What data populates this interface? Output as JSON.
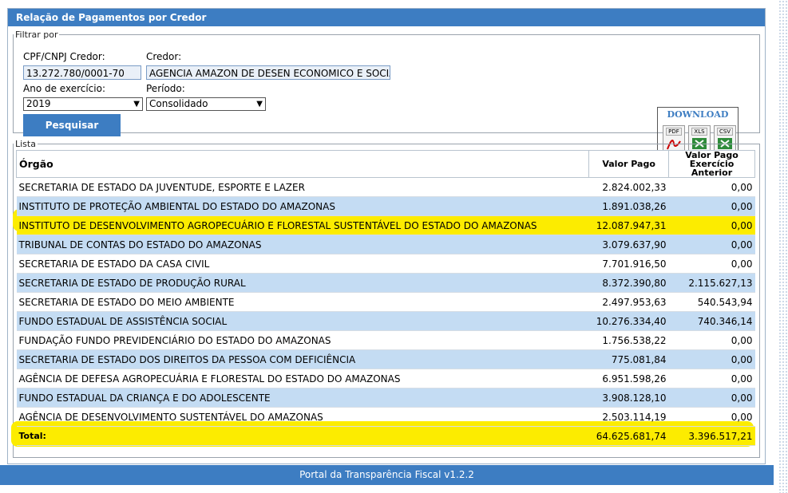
{
  "panel": {
    "title": "Relação de Pagamentos por Credor"
  },
  "filter": {
    "legend": "Filtrar por",
    "cpf_label": "CPF/CNPJ Credor:",
    "cpf_value": "13.272.780/0001-70",
    "credor_label": "Credor:",
    "credor_value": "AGENCIA AMAZON DE DESEN ECONOMICO E SOCIAL- A",
    "ano_label": "Ano de exercício:",
    "ano_value": "2019",
    "periodo_label": "Período:",
    "periodo_value": "Consolidado",
    "search_button": "Pesquisar"
  },
  "download": {
    "title": "DOWNLOAD",
    "pdf": "PDF",
    "xls": "XLS",
    "csv": "CSV"
  },
  "lista": {
    "legend": "Lista",
    "headers": {
      "orgao": "Órgão",
      "valor_pago": "Valor Pago",
      "valor_anterior_1": "Valor Pago",
      "valor_anterior_2": "Exercício Anterior"
    },
    "rows": [
      {
        "orgao": "SECRETARIA DE ESTADO DA JUVENTUDE, ESPORTE E LAZER",
        "valor": "2.824.002,33",
        "anterior": "0,00"
      },
      {
        "orgao": "INSTITUTO DE PROTEÇÃO AMBIENTAL DO ESTADO DO AMAZONAS",
        "valor": "1.891.038,26",
        "anterior": "0,00"
      },
      {
        "orgao": "INSTITUTO DE DESENVOLVIMENTO AGROPECUÁRIO E FLORESTAL SUSTENTÁVEL DO ESTADO DO AMAZONAS",
        "valor": "12.087.947,31",
        "anterior": "0,00"
      },
      {
        "orgao": "TRIBUNAL DE CONTAS DO ESTADO DO AMAZONAS",
        "valor": "3.079.637,90",
        "anterior": "0,00"
      },
      {
        "orgao": "SECRETARIA DE ESTADO DA CASA CIVIL",
        "valor": "7.701.916,50",
        "anterior": "0,00"
      },
      {
        "orgao": "SECRETARIA DE ESTADO DE PRODUÇÃO RURAL",
        "valor": "8.372.390,80",
        "anterior": "2.115.627,13"
      },
      {
        "orgao": "SECRETARIA DE ESTADO DO MEIO AMBIENTE",
        "valor": "2.497.953,63",
        "anterior": "540.543,94"
      },
      {
        "orgao": "FUNDO ESTADUAL DE ASSISTÊNCIA SOCIAL",
        "valor": "10.276.334,40",
        "anterior": "740.346,14"
      },
      {
        "orgao": "FUNDAÇÃO FUNDO PREVIDENCIÁRIO DO ESTADO DO AMAZONAS",
        "valor": "1.756.538,22",
        "anterior": "0,00"
      },
      {
        "orgao": "SECRETARIA DE ESTADO DOS DIREITOS DA PESSOA COM DEFICIÊNCIA",
        "valor": "775.081,84",
        "anterior": "0,00"
      },
      {
        "orgao": "AGÊNCIA DE DEFESA AGROPECUÁRIA E FLORESTAL DO ESTADO DO AMAZONAS",
        "valor": "6.951.598,26",
        "anterior": "0,00"
      },
      {
        "orgao": "FUNDO ESTADUAL DA CRIANÇA E DO ADOLESCENTE",
        "valor": "3.908.128,10",
        "anterior": "0,00"
      },
      {
        "orgao": "AGÊNCIA DE DESENVOLVIMENTO SUSTENTÁVEL DO AMAZONAS",
        "valor": "2.503.114,19",
        "anterior": "0,00"
      }
    ],
    "total": {
      "label": "Total:",
      "valor": "64.625.681,74",
      "anterior": "3.396.517,21"
    }
  },
  "colors": {
    "header_blue": "#3d7dc2",
    "row_alt": "#c4dcf3",
    "highlight": "#fcec00"
  },
  "footer": {
    "text": "Portal da Transparência Fiscal v1.2.2"
  }
}
